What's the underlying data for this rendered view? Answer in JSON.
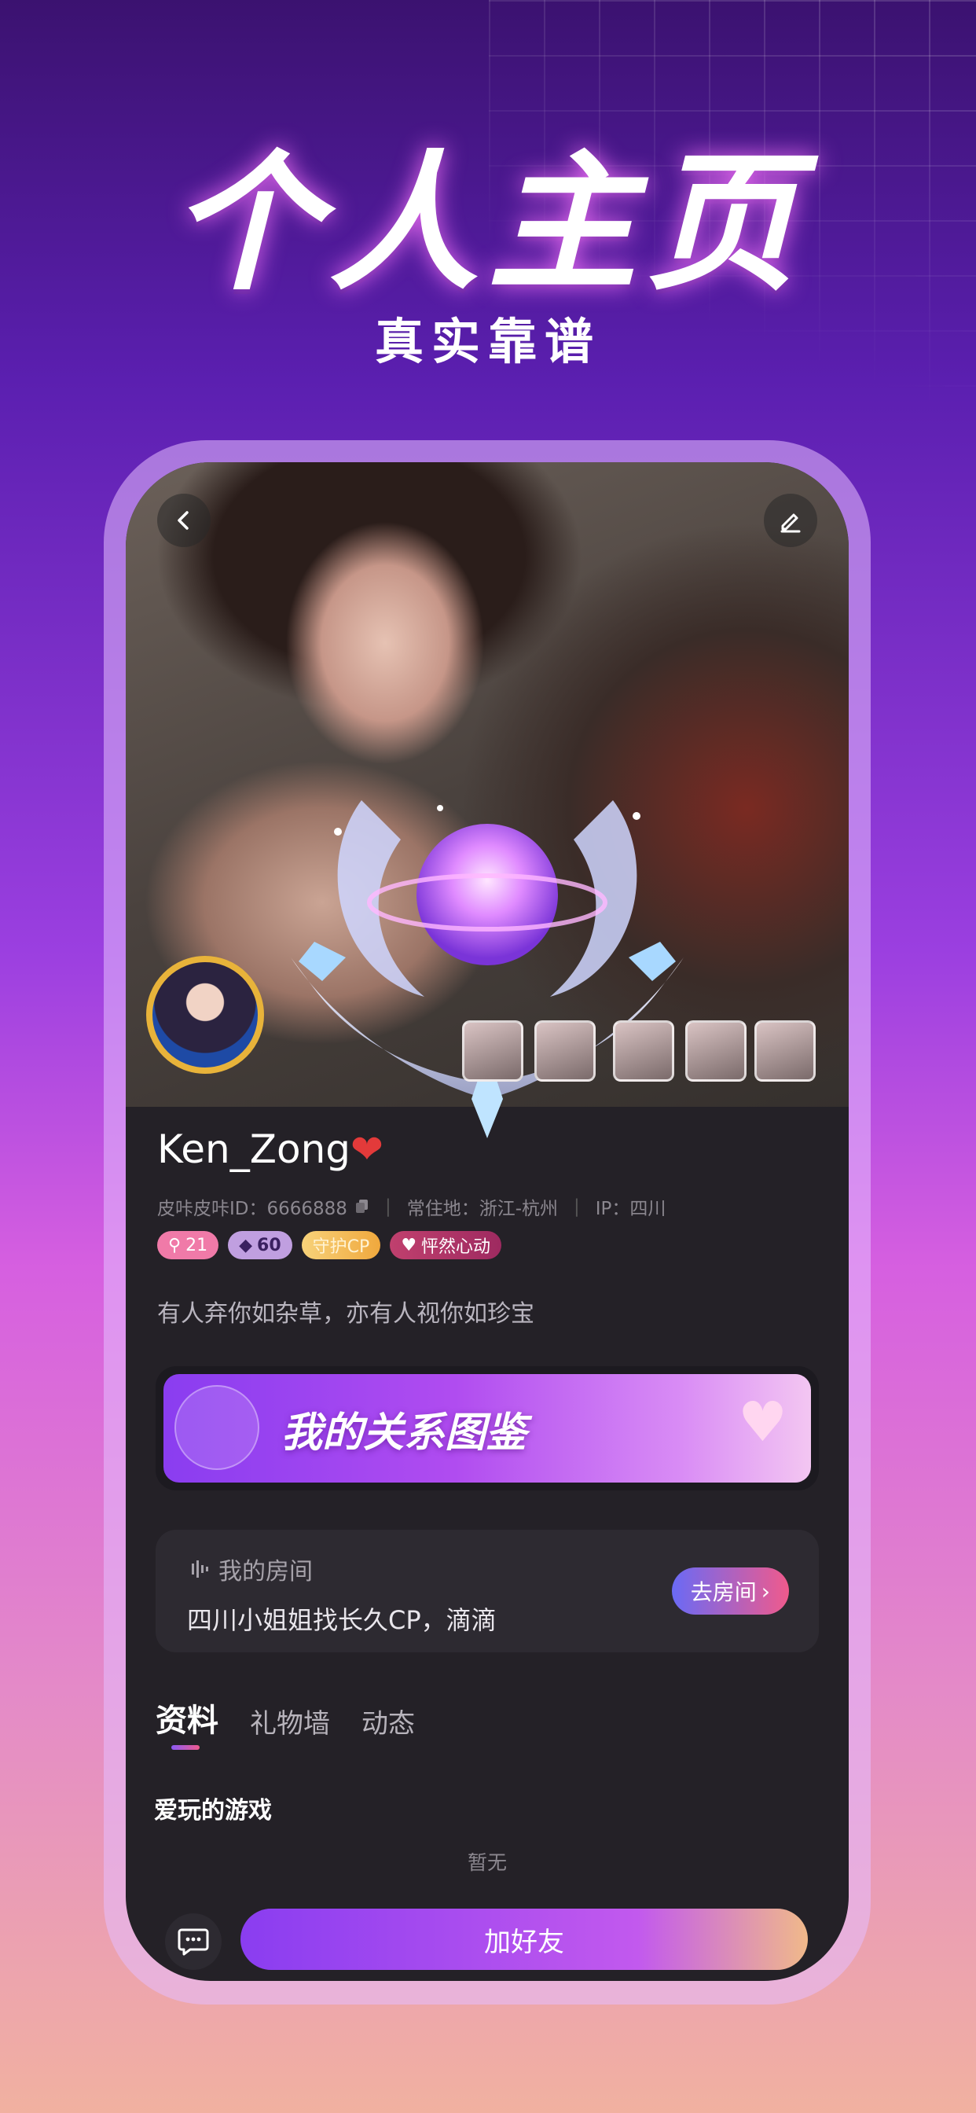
{
  "promo": {
    "title": "个人主页",
    "subtitle": "真实靠谱"
  },
  "profile": {
    "username": "Ken_Zong",
    "heart": "❤",
    "id_label": "皮咔皮咔ID：6666888",
    "location_label": "常住地：浙江-杭州",
    "ip_label": "IP：四川",
    "badges": [
      "21",
      "60",
      "守护CP",
      "怦然心动"
    ],
    "bio": "有人弃你如杂草，亦有人视你如珍宝"
  },
  "relation_banner": {
    "title": "我的关系图鉴"
  },
  "room": {
    "label": "我的房间",
    "name": "四川小姐姐找长久CP，滴滴",
    "button": "去房间"
  },
  "tabs": [
    {
      "label": "资料",
      "active": true
    },
    {
      "label": "礼物墙",
      "active": false
    },
    {
      "label": "动态",
      "active": false
    }
  ],
  "sections": {
    "games_title": "爱玩的游戏",
    "games_empty": "暂无"
  },
  "bottom": {
    "add_friend": "加好友"
  },
  "icons": [
    "back-icon",
    "edit-icon",
    "copy-icon",
    "sound-wave-icon",
    "chevron-right-icon",
    "chat-icon"
  ]
}
